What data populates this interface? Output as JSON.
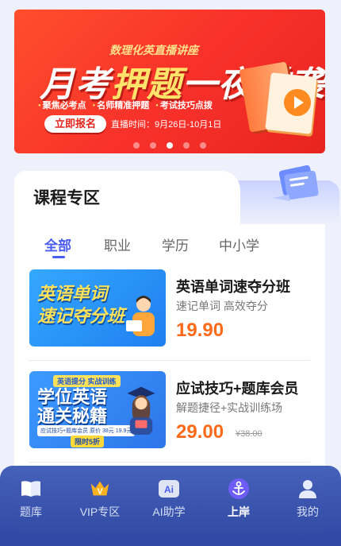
{
  "banner": {
    "subtitle": "数理化英直播讲座",
    "title_a": "月考",
    "title_b": "押题",
    "title_c": "一夜逆袭",
    "points": [
      "聚焦必考点",
      "名师精准押题",
      "考试技巧点拨"
    ],
    "button": "立即报名",
    "date": "直播时间：9月26日-10月1日",
    "slides": 5,
    "active_slide": 3
  },
  "zone": {
    "title": "课程专区"
  },
  "tabs": [
    {
      "label": "全部",
      "active": true
    },
    {
      "label": "职业",
      "active": false
    },
    {
      "label": "学历",
      "active": false
    },
    {
      "label": "中小学",
      "active": false
    }
  ],
  "courses": [
    {
      "thumb_line1": "英语单词",
      "thumb_line2": "速记夺分班",
      "title": "英语单词速夺分班",
      "subtitle": "速记单词 高效夺分",
      "price": "19.90",
      "original_price": ""
    },
    {
      "thumb_tag": "英语提分 实战训练",
      "thumb_line1": "学位英语",
      "thumb_line2": "通关秘籍",
      "thumb_promo": "应试技巧+题库会员 原价 38元 19.9元",
      "thumb_badge": "限时5折",
      "title": "应试技巧+题库会员",
      "subtitle": "解题捷径+实战训练场",
      "price": "29.00",
      "original_price": "¥38.00"
    }
  ],
  "nav": {
    "items": [
      {
        "label": "题库",
        "icon": "book-icon",
        "active": false
      },
      {
        "label": "VIP专区",
        "icon": "vip-crown-icon",
        "active": false
      },
      {
        "label": "AI助学",
        "icon": "ai-icon",
        "active": false
      },
      {
        "label": "上岸",
        "icon": "anchor-icon",
        "active": true
      },
      {
        "label": "我的",
        "icon": "user-icon",
        "active": false
      }
    ]
  },
  "colors": {
    "accent": "#4a5cf0",
    "price": "#ff6a1a",
    "banner": "#f7302a",
    "nav": "#2f4aa8"
  }
}
